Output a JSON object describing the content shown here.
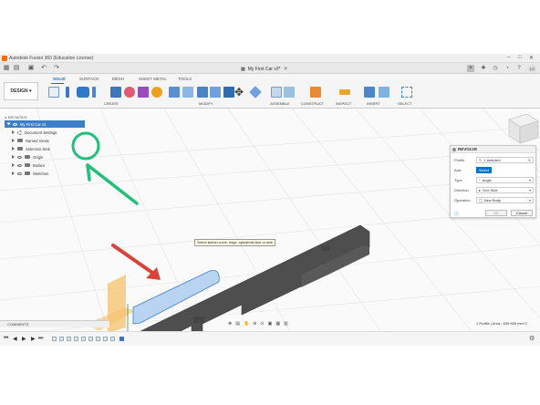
{
  "window": {
    "title": "Autodesk Fusion 360 (Education License)",
    "document_tab": "My First Car v2*"
  },
  "user": {
    "initials": "CC"
  },
  "workspace": {
    "label": "DESIGN"
  },
  "ribbon": {
    "tabs": [
      "SOLID",
      "SURFACE",
      "MESH",
      "SHEET METAL",
      "TOOLS"
    ],
    "active_tab": "SOLID",
    "groups": [
      "CREATE",
      "MODIFY",
      "ASSEMBLE",
      "CONSTRUCT",
      "INSPECT",
      "INSERT",
      "SELECT"
    ]
  },
  "browser": {
    "header": "BROWSER",
    "root": "My First Car v2",
    "items": [
      "Document Settings",
      "Named Views",
      "Selection Sets",
      "Origin",
      "Bodies",
      "Sketches"
    ]
  },
  "revolve_panel": {
    "title": "REVOLVE",
    "rows": [
      {
        "label": "Profile",
        "value": "1 selected"
      },
      {
        "label": "Axis",
        "value": "Select"
      },
      {
        "label": "Type",
        "value": "Angle"
      },
      {
        "label": "Direction",
        "value": "One Side"
      },
      {
        "label": "Operation",
        "value": "New Body"
      }
    ],
    "ok": "OK",
    "cancel": "Cancel"
  },
  "tooltip": "Select sketch curve, edge, cylindrical face or axis",
  "comments": {
    "label": "COMMENTS"
  },
  "status": "1 Profile | Area : 839.965 mm^2",
  "colors": {
    "accent": "#0a72c9",
    "highlight_circle": "#22c07a",
    "arrow_green": "#22c07a",
    "arrow_red": "#d9443a",
    "body": "#5a5a5a",
    "profile": "#b8d4f0"
  }
}
